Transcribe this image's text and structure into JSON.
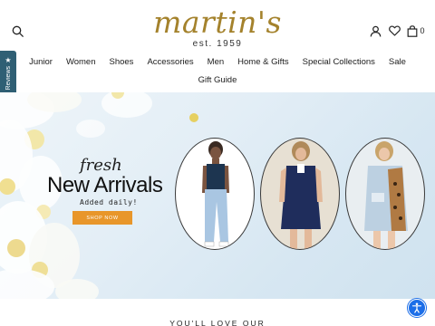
{
  "brand": {
    "name": "martin's",
    "established": "est. 1959",
    "gold_color": "#a4822c"
  },
  "header": {
    "cart_count": "0",
    "icons": [
      "search-icon",
      "account-icon",
      "heart-icon",
      "bag-icon"
    ]
  },
  "nav": {
    "row1": [
      "Junior",
      "Women",
      "Shoes",
      "Accessories",
      "Men",
      "Home & Gifts",
      "Special Collections",
      "Sale"
    ],
    "row2": [
      "Gift Guide"
    ]
  },
  "reviews_tab": {
    "label": "Reviews",
    "color": "#2f5f74"
  },
  "hero": {
    "script_text": "fresh",
    "title": "New Arrivals",
    "subtitle": "Added daily!",
    "cta_label": "SHOP NOW",
    "cta_color": "#e8962a"
  },
  "section": {
    "heading": "YOU'LL LOVE OUR"
  },
  "accessibility": {
    "icon": "accessibility-icon",
    "color": "#1c6ee8"
  }
}
